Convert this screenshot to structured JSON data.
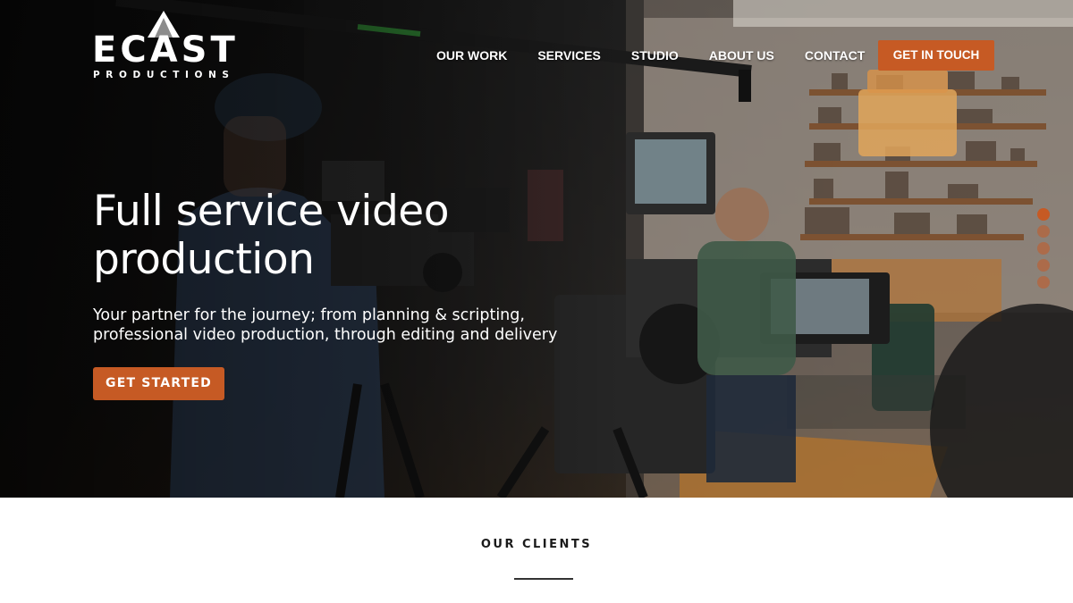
{
  "brand": {
    "name": "ECAST",
    "sub": "PRODUCTIONS"
  },
  "nav": {
    "items": [
      "OUR WORK",
      "SERVICES",
      "STUDIO",
      "ABOUT US",
      "CONTACT"
    ],
    "cta": "GET IN TOUCH"
  },
  "hero": {
    "headline_line1": "Full service video",
    "headline_line2": "production",
    "sub_line1": "Your partner for the journey; from planning & scripting,",
    "sub_line2": "professional video production, through editing and delivery",
    "cta": "GET STARTED",
    "slides": 5,
    "active_slide": 1
  },
  "clients": {
    "title": "OUR CLIENTS"
  },
  "colors": {
    "accent": "#c65a24"
  }
}
